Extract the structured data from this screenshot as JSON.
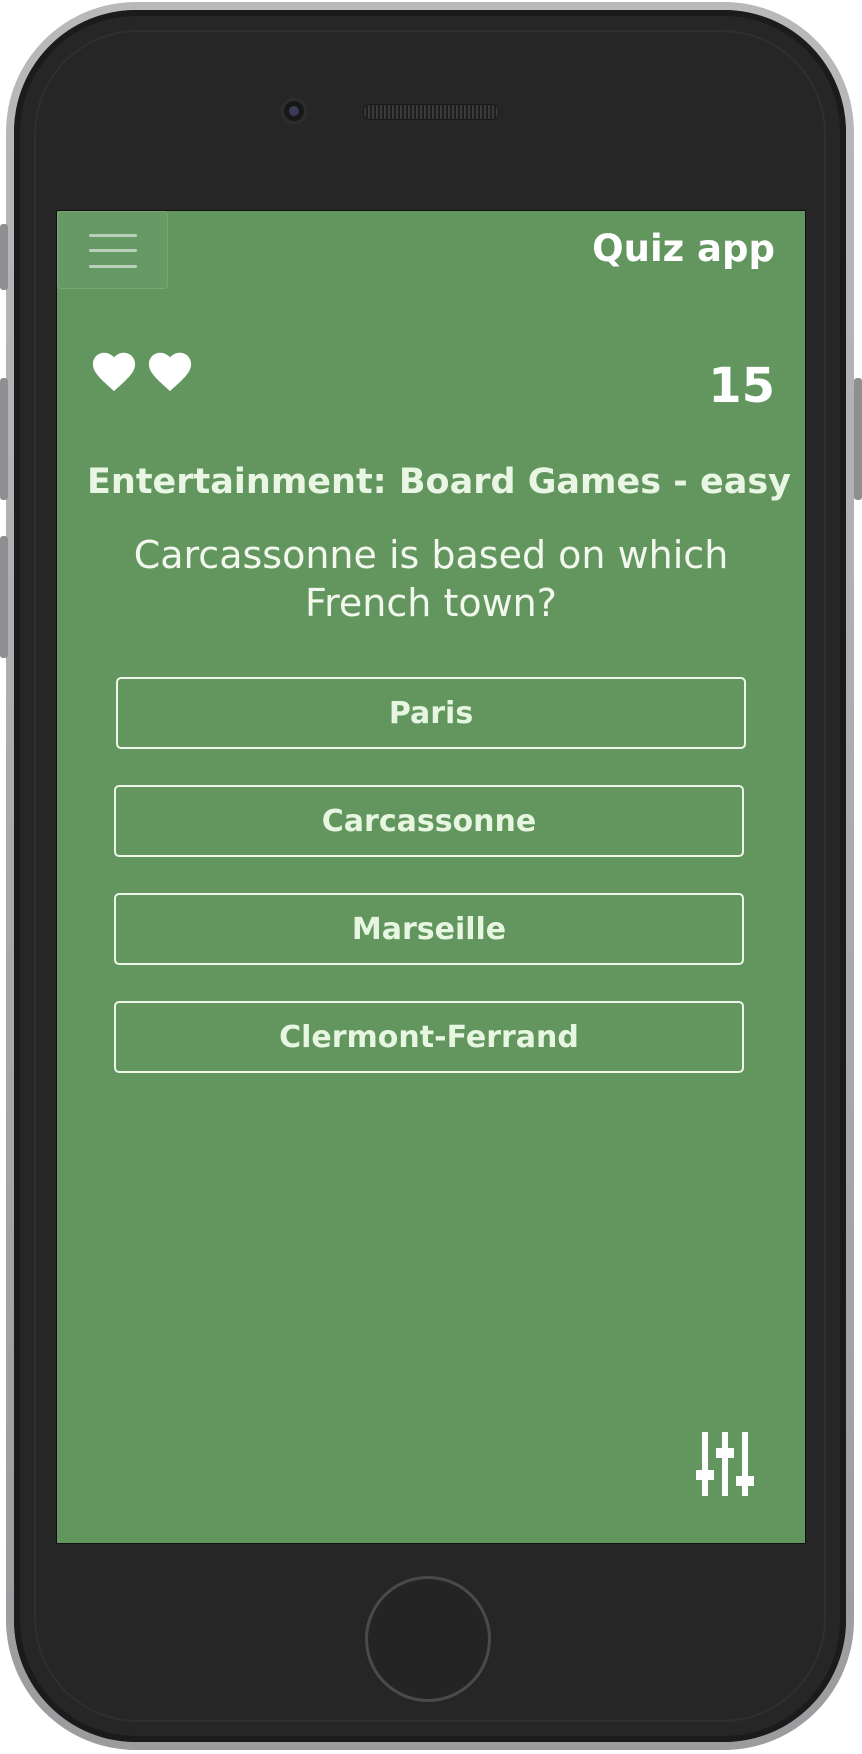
{
  "app": {
    "title": "Quiz app"
  },
  "status": {
    "lives": 2,
    "score": "15"
  },
  "question": {
    "category_line": "Entertainment: Board Games - easy",
    "text": "Carcassonne is based on which French town?"
  },
  "answers": [
    {
      "label": "Paris"
    },
    {
      "label": "Carcassonne"
    },
    {
      "label": "Marseille"
    },
    {
      "label": "Clermont-Ferrand"
    }
  ],
  "icons": {
    "menu": "hamburger-menu-icon",
    "life": "heart-icon",
    "settings": "sliders-settings-icon"
  },
  "colors": {
    "background": "#63965f",
    "text": "#ffffff",
    "answer_border": "#eef6ea",
    "device_body": "#262626"
  }
}
